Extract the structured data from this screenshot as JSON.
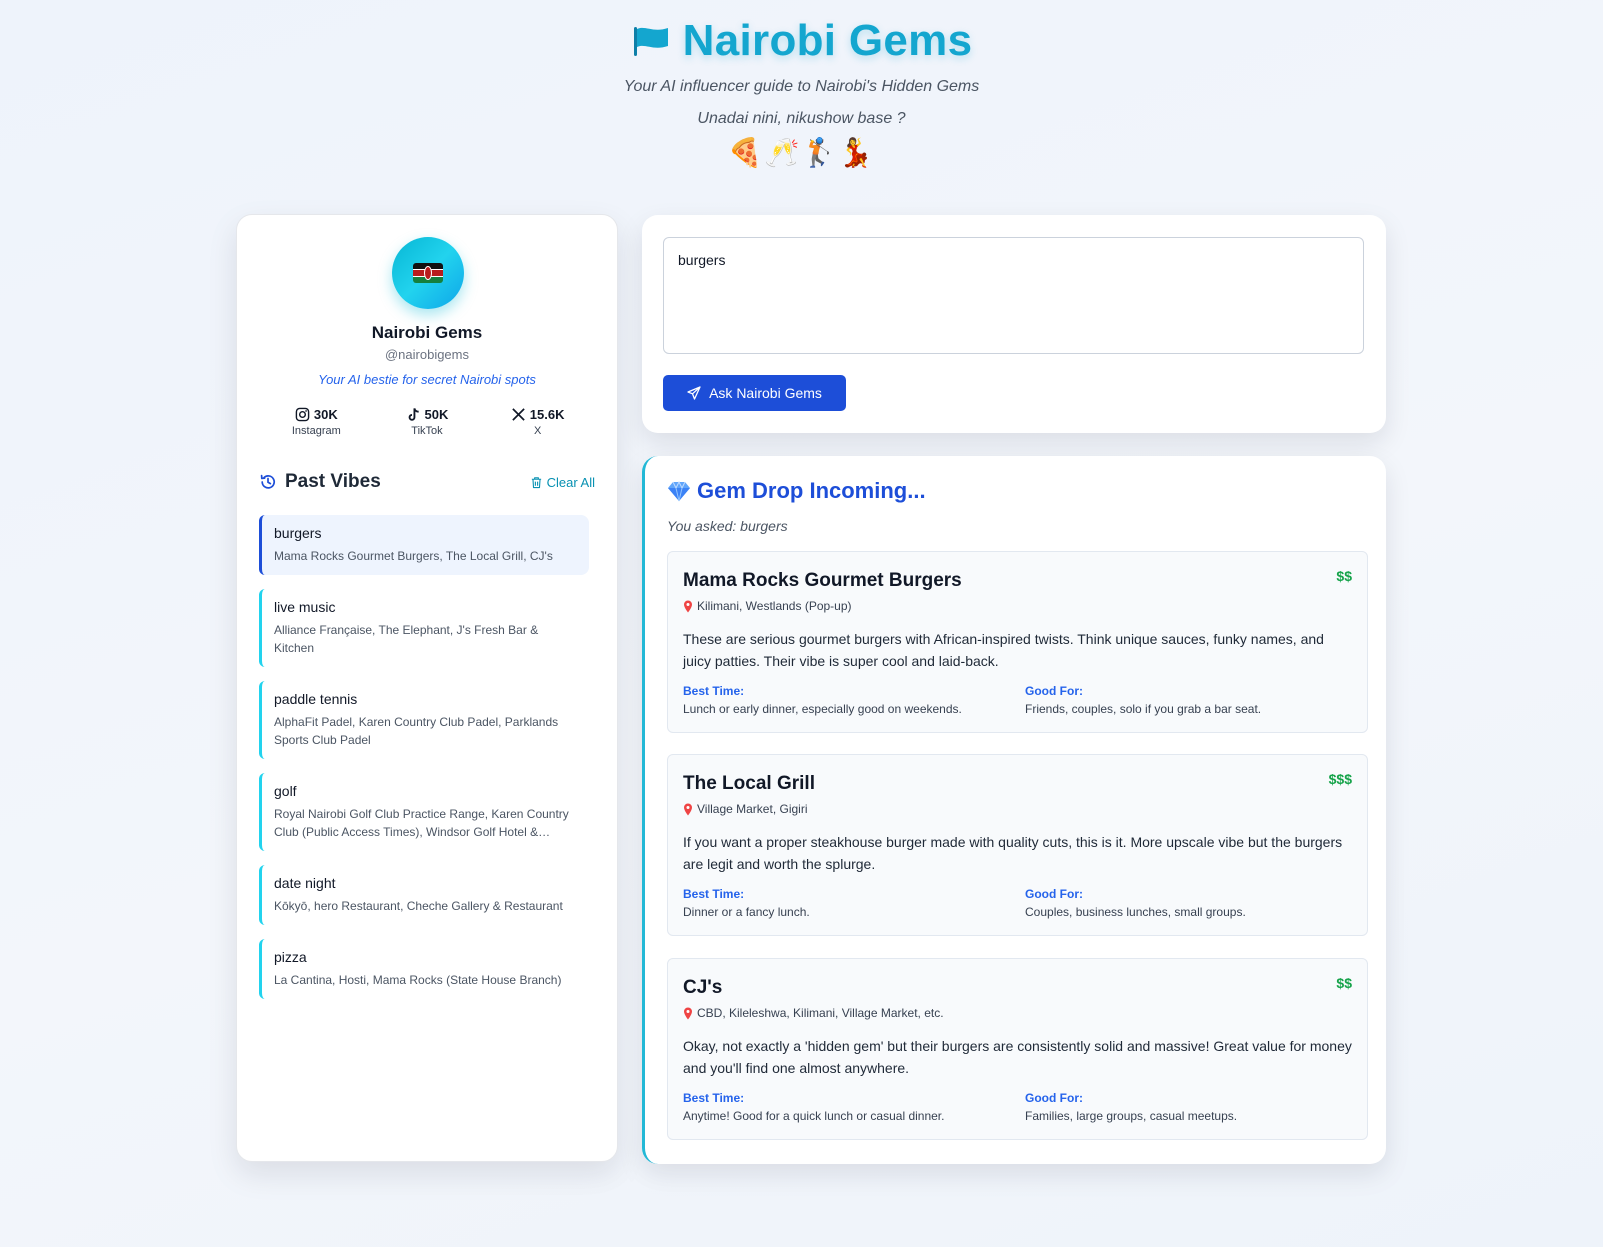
{
  "header": {
    "title": "Nairobi Gems",
    "subtitle": "Your AI influencer guide to Nairobi's Hidden Gems",
    "tagline": "Unadai nini, nikushow base ?",
    "emojis": "🍕🥂🏌️💃"
  },
  "profile": {
    "name": "Nairobi Gems",
    "handle": "@nairobigems",
    "bio": "Your AI bestie for secret Nairobi spots",
    "stats": [
      {
        "icon": "instagram-icon",
        "value": "30K",
        "label": "Instagram"
      },
      {
        "icon": "tiktok-icon",
        "value": "50K",
        "label": "TikTok"
      },
      {
        "icon": "x-icon",
        "value": "15.6K",
        "label": "X"
      }
    ]
  },
  "history": {
    "title": "Past Vibes",
    "clear_label": "Clear All",
    "items": [
      {
        "query": "burgers",
        "answer": "Mama Rocks Gourmet Burgers, The Local Grill, CJ's",
        "active": true
      },
      {
        "query": "live music",
        "answer": "Alliance Française, The Elephant, J's Fresh Bar & Kitchen"
      },
      {
        "query": "paddle tennis",
        "answer": "AlphaFit Padel, Karen Country Club Padel, Parklands Sports Club Padel"
      },
      {
        "query": "golf",
        "answer": "Royal Nairobi Golf Club Practice Range, Karen Country Club (Public Access Times), Windsor Golf Hotel & Country Club"
      },
      {
        "query": "date night",
        "answer": "Kōkyō, hero Restaurant, Cheche Gallery & Restaurant"
      },
      {
        "query": "pizza",
        "answer": "La Cantina, Hosti, Mama Rocks (State House Branch)"
      }
    ]
  },
  "query": {
    "value": "burgers",
    "button_label": "Ask Nairobi Gems"
  },
  "results": {
    "title": "Gem Drop Incoming...",
    "asked": "You asked: burgers",
    "best_time_label": "Best Time:",
    "good_for_label": "Good For:",
    "spots": [
      {
        "name": "Mama Rocks Gourmet Burgers",
        "price": "$$",
        "location": "Kilimani, Westlands (Pop-up)",
        "description": "These are serious gourmet burgers with African-inspired twists. Think unique sauces, funky names, and juicy patties. Their vibe is super cool and laid-back.",
        "best_time": "Lunch or early dinner, especially good on weekends.",
        "good_for": "Friends, couples, solo if you grab a bar seat."
      },
      {
        "name": "The Local Grill",
        "price": "$$$",
        "location": "Village Market, Gigiri",
        "description": "If you want a proper steakhouse burger made with quality cuts, this is it. More upscale vibe but the burgers are legit and worth the splurge.",
        "best_time": "Dinner or a fancy lunch.",
        "good_for": "Couples, business lunches, small groups."
      },
      {
        "name": "CJ's",
        "price": "$$",
        "location": "CBD, Kileleshwa, Kilimani, Village Market, etc.",
        "description": "Okay, not exactly a 'hidden gem' but their burgers are consistently solid and massive! Great value for money and you'll find one almost anywhere.",
        "best_time": "Anytime! Good for a quick lunch or casual dinner.",
        "good_for": "Families, large groups, casual meetups."
      }
    ]
  },
  "colors": {
    "title": "#14a6cf",
    "accent_blue": "#1d4ed8",
    "accent_cyan": "#22d3ee",
    "price_green": "#16a34a"
  }
}
